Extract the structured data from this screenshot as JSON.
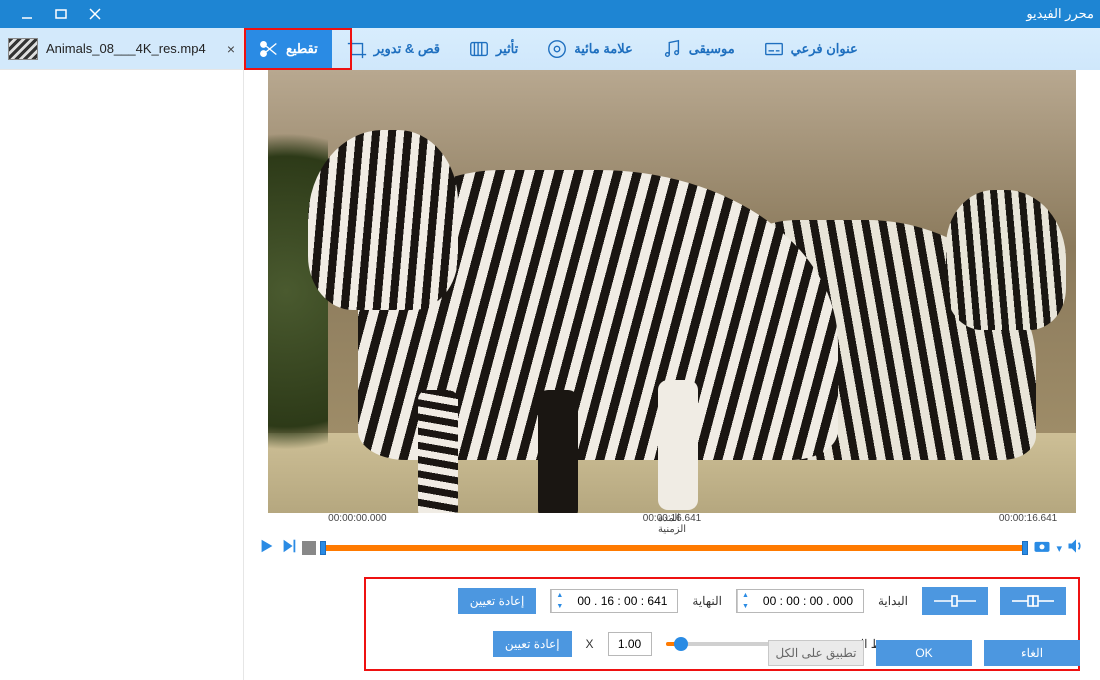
{
  "window": {
    "title": "محرر الفيديو"
  },
  "file": {
    "name": "Animals_08___4K_res.mp4"
  },
  "toolbar": {
    "cut": "تقطيع",
    "crop": "قص & تدوير",
    "effect": "تأثير",
    "watermark": "علامة مائية",
    "music": "موسيقى",
    "subtitle": "عنوان فرعي"
  },
  "timeline": {
    "start_time": "00:00:00.000",
    "mid_label": "المدة الزمنية",
    "mid_time": "00:00:16.641",
    "end_time": "00:00:16.641"
  },
  "controls": {
    "start_label": "البداية",
    "start_value": "00 : 00 : 00 . 000",
    "end_label": "النهاية",
    "end_value": "00 . 16 : 00 : 641",
    "reset_label": "إعادة تعيين",
    "speed_label": "ضبط السرعة",
    "speed_value": "1.00",
    "speed_x": "X",
    "speed_reset": "إعادة تعيين"
  },
  "footer": {
    "apply_all": "تطبيق على الكل",
    "ok": "OK",
    "cancel": "الغاء"
  }
}
